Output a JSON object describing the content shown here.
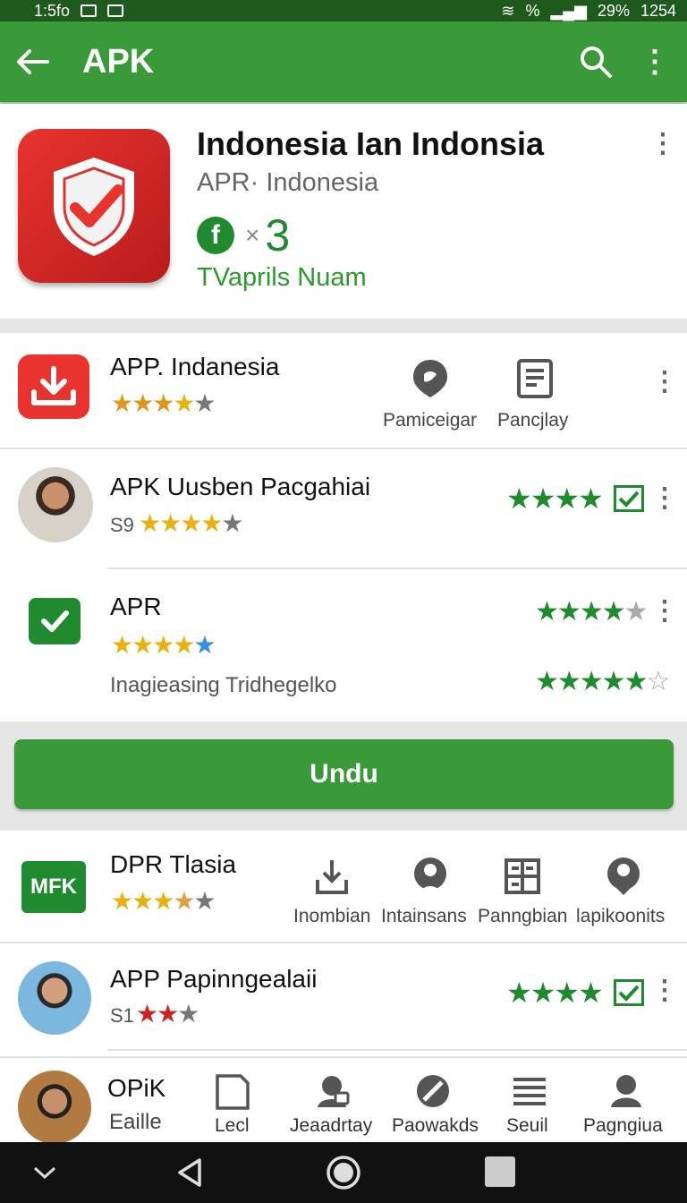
{
  "status_bar": {
    "time": "1:5fo",
    "battery": "29%",
    "extra": "1254",
    "signal_label": "%"
  },
  "app_bar": {
    "title": "APK"
  },
  "hero": {
    "title": "Indonesia Ian Indonsia",
    "subtitle": "APR· Indonesia",
    "badge_letter": "f",
    "multiplier": "×",
    "count": "3",
    "tagline": "TVaprils Nuam"
  },
  "items": [
    {
      "title": "APP. Indanesia",
      "actions": [
        "Pamiceigar",
        "Pancjlay"
      ]
    },
    {
      "title": "APK Uusben Pacgahiai",
      "prefix": "S9"
    },
    {
      "title": "APR",
      "description": "Inagieasing Tridhegelko"
    },
    {
      "title": "DPR Tlasia",
      "badge": "MFK",
      "actions": [
        "Inombian",
        "Intainsans",
        "Panngbian",
        "lapikoonits"
      ]
    },
    {
      "title": "APP Papinngealaii",
      "prefix": "S1"
    }
  ],
  "button": {
    "label": "Undu"
  },
  "bottom_nav": {
    "profile_title": "OPiK",
    "profile_sub": "Eaille",
    "items": [
      "Lecl",
      "Jeaadrtay",
      "Paowakds",
      "Seuil",
      "Pagngiua"
    ]
  },
  "colors": {
    "primary": "#3a9a3a",
    "status": "#1e5a1e",
    "accent_red": "#e8332e",
    "star_gold": "#e8b10f",
    "star_green": "#1f8a2e"
  }
}
